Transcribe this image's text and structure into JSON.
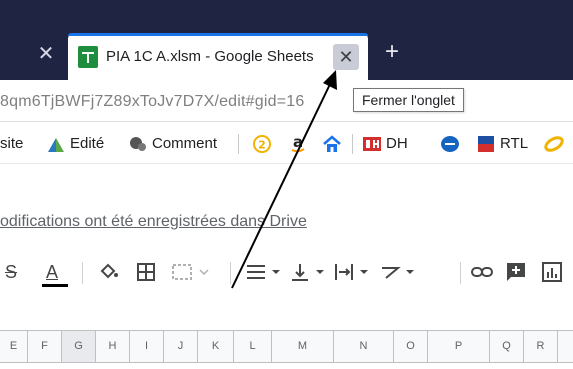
{
  "browser": {
    "tabs": [
      {
        "title": "PIA 1C A.xlsm - Google Sheets",
        "active": true
      }
    ],
    "prev_tab_close": "✕",
    "close_glyph": "✕",
    "new_tab_glyph": "+",
    "url": "8qm6TjBWFj7Z89xToJv7D7X/edit#gid=16",
    "tooltip": "Fermer l'onglet"
  },
  "bookmarks": {
    "items": [
      {
        "label": "site"
      },
      {
        "label": "Edité"
      },
      {
        "label": "Comment"
      },
      {
        "label": "DH"
      },
      {
        "label": "RTL"
      }
    ]
  },
  "sheet": {
    "save_status": "odifications ont été enregistrées dans Drive",
    "columns": [
      "E",
      "F",
      "G",
      "H",
      "I",
      "J",
      "K",
      "L",
      "M",
      "N",
      "O",
      "P",
      "Q",
      "R"
    ],
    "selected_column": "G"
  },
  "toolbar": {
    "text_color_glyph": "A",
    "strikethrough_glyph": "S"
  },
  "colors": {
    "tabstrip": "#202443",
    "sheets_green": "#1e8e3e",
    "accent_blue": "#1a73e8"
  }
}
